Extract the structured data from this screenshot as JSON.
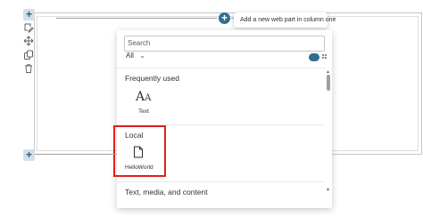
{
  "section_toolbar": {
    "add_label": "+",
    "add_bottom_label": "+"
  },
  "insert_tooltip": "Add a new web part in column one",
  "picker": {
    "search_placeholder": "Search",
    "filter_label": "All",
    "sections": [
      {
        "title": "Frequently used",
        "items": [
          {
            "label": "Text",
            "icon": "text-icon"
          }
        ]
      },
      {
        "title": "Local",
        "items": [
          {
            "label": "HelloWorld",
            "icon": "document-icon"
          }
        ]
      },
      {
        "title": "Text, media, and content"
      }
    ]
  },
  "colors": {
    "accent": "#2f6f8f",
    "highlight": "#e0201b"
  }
}
